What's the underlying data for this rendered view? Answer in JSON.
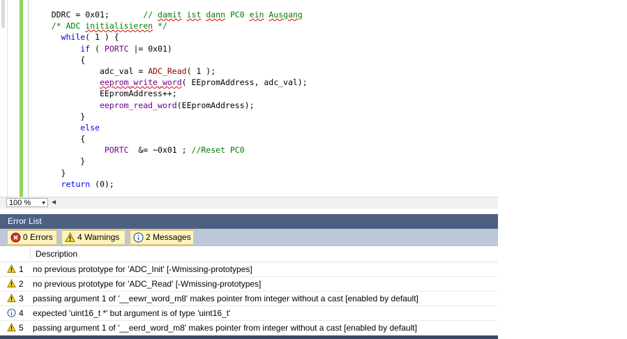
{
  "editor": {
    "lines": [
      {
        "indent": 4,
        "parts": [
          {
            "t": "DDRC = 0x01;       ",
            "c": ""
          },
          {
            "t": "// ",
            "c": "cm"
          },
          {
            "t": "damit",
            "c": "cm sq"
          },
          {
            "t": " ",
            "c": "cm"
          },
          {
            "t": "ist",
            "c": "cm sq"
          },
          {
            "t": " ",
            "c": "cm"
          },
          {
            "t": "dann",
            "c": "cm sq"
          },
          {
            "t": " PC0 ",
            "c": "cm"
          },
          {
            "t": "ein",
            "c": "cm sq"
          },
          {
            "t": " ",
            "c": "cm"
          },
          {
            "t": "Ausgang",
            "c": "cm sq"
          }
        ]
      },
      {
        "indent": 4,
        "parts": [
          {
            "t": "/* ADC ",
            "c": "cm"
          },
          {
            "t": "initialisieren",
            "c": "cm sq"
          },
          {
            "t": " */",
            "c": "cm"
          }
        ]
      },
      {
        "indent": 6,
        "parts": [
          {
            "t": "while",
            "c": "kw"
          },
          {
            "t": "( 1 ) {",
            "c": ""
          }
        ]
      },
      {
        "indent": 10,
        "parts": [
          {
            "t": "if",
            "c": "kw"
          },
          {
            "t": " ( ",
            "c": ""
          },
          {
            "t": "PORTC",
            "c": "mac"
          },
          {
            "t": " |= 0x01)",
            "c": ""
          }
        ]
      },
      {
        "indent": 10,
        "parts": [
          {
            "t": "{",
            "c": ""
          }
        ]
      },
      {
        "indent": 14,
        "parts": [
          {
            "t": "adc_val = ",
            "c": ""
          },
          {
            "t": "ADC_Read",
            "c": "fn"
          },
          {
            "t": "( 1 );",
            "c": ""
          }
        ]
      },
      {
        "indent": 14,
        "parts": [
          {
            "t": "eeprom_write_word",
            "c": "mac sq"
          },
          {
            "t": "( EEpromAddress, adc_val);",
            "c": ""
          }
        ]
      },
      {
        "indent": 14,
        "parts": [
          {
            "t": "EEpromAddress++;",
            "c": ""
          }
        ]
      },
      {
        "indent": 14,
        "parts": [
          {
            "t": "eeprom_read_word",
            "c": "mac"
          },
          {
            "t": "(EEpromAddress);",
            "c": ""
          }
        ]
      },
      {
        "indent": 10,
        "parts": [
          {
            "t": "}",
            "c": ""
          }
        ]
      },
      {
        "indent": 10,
        "parts": [
          {
            "t": "else",
            "c": "kw"
          }
        ]
      },
      {
        "indent": 10,
        "parts": [
          {
            "t": "{",
            "c": ""
          }
        ]
      },
      {
        "indent": 15,
        "parts": [
          {
            "t": "PORTC",
            "c": "mac"
          },
          {
            "t": "  &= ~0x01 ; ",
            "c": ""
          },
          {
            "t": "//Reset PC0",
            "c": "cm"
          }
        ]
      },
      {
        "indent": 10,
        "parts": [
          {
            "t": "}",
            "c": ""
          }
        ]
      },
      {
        "indent": 6,
        "parts": [
          {
            "t": "}",
            "c": ""
          }
        ]
      },
      {
        "indent": 6,
        "parts": [
          {
            "t": "return",
            "c": "kw"
          },
          {
            "t": " (0);",
            "c": ""
          }
        ]
      }
    ]
  },
  "zoom": {
    "value": "100 %"
  },
  "error_list": {
    "title": "Error List",
    "buttons": {
      "errors": "0 Errors",
      "warnings": "4 Warnings",
      "messages": "2 Messages"
    },
    "column_description": "Description",
    "rows": [
      {
        "icon": "warning-icon",
        "num": "1",
        "text": "no previous prototype for 'ADC_Init' [-Wmissing-prototypes]"
      },
      {
        "icon": "warning-icon",
        "num": "2",
        "text": "no previous prototype for 'ADC_Read' [-Wmissing-prototypes]"
      },
      {
        "icon": "warning-icon",
        "num": "3",
        "text": "passing argument 1 of '__eewr_word_m8' makes pointer from integer without a cast [enabled by default]"
      },
      {
        "icon": "info-icon",
        "num": "4",
        "text": "expected 'uint16_t *' but argument is of type 'uint16_t'"
      },
      {
        "icon": "warning-icon",
        "num": "5",
        "text": "passing argument 1 of '__eerd_word_m8' makes pointer from integer without a cast [enabled by default]"
      }
    ]
  },
  "colors": {
    "panel_title": "#4d6082",
    "toolbar": "#bcc7d8",
    "change_bar": "#8fd65c"
  }
}
